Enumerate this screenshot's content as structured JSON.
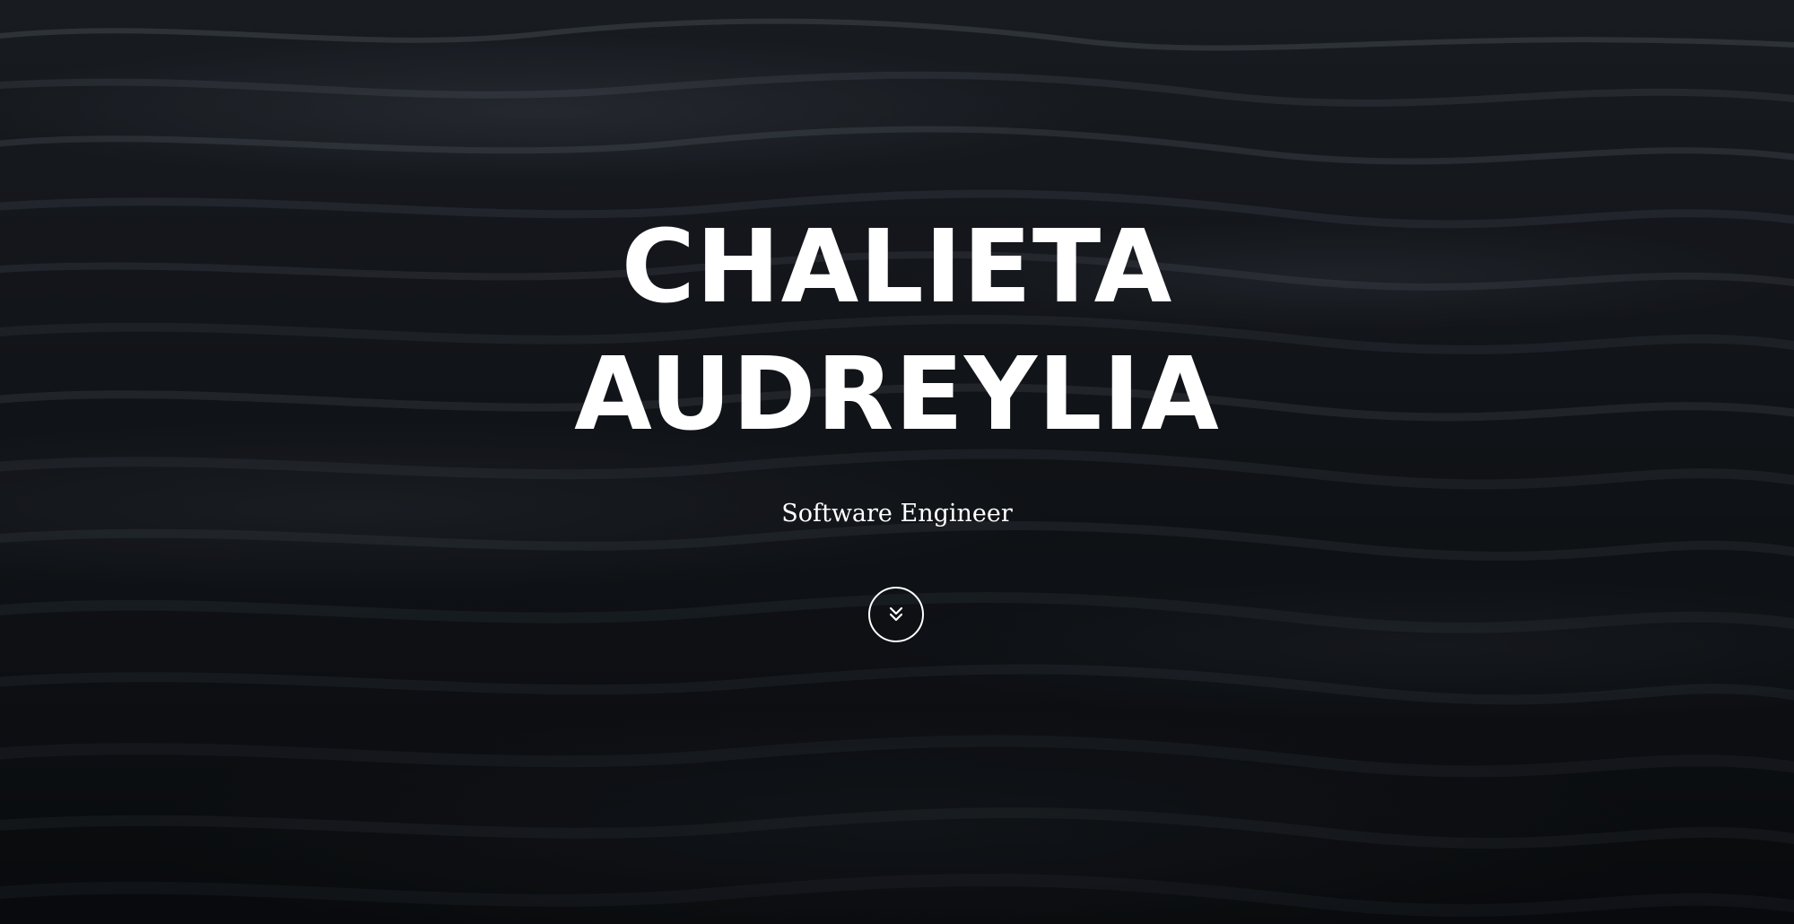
{
  "hero": {
    "name_line_1": "CHALIETA",
    "name_line_2": "AUDREYLIA",
    "subtitle": "Software Engineer",
    "scroll_icon": "double-chevron-down-icon",
    "background": "dark-ocean-waves"
  },
  "colors": {
    "text": "#ffffff",
    "background": "#14171c"
  }
}
